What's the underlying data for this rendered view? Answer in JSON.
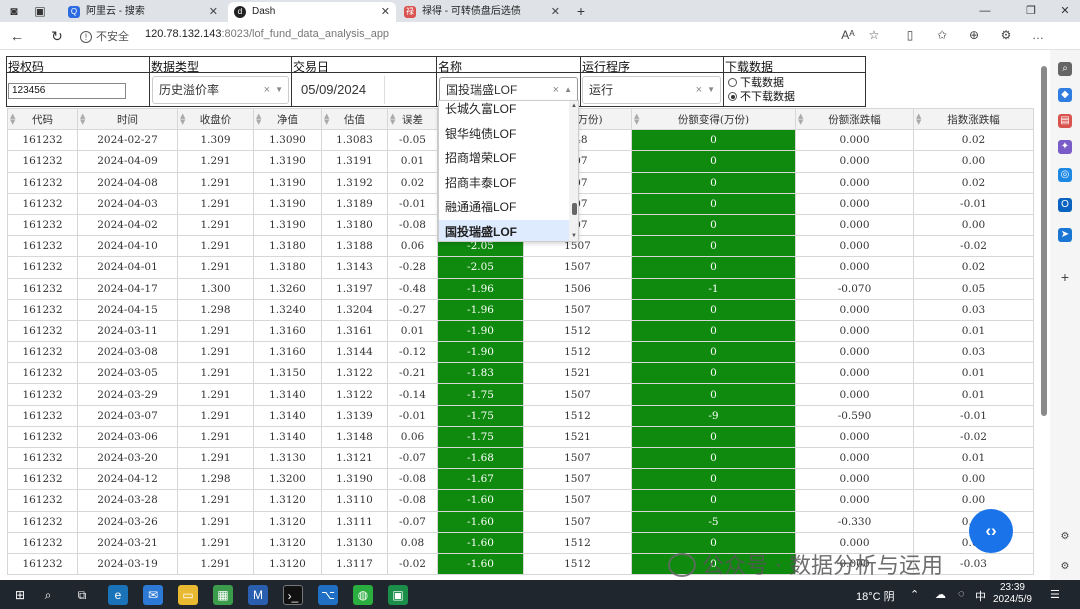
{
  "browser": {
    "tabs": [
      {
        "title": "阿里云 - 搜索",
        "active": false
      },
      {
        "title": "Dash",
        "active": true
      },
      {
        "title": "禄得 - 可转债盘后选债",
        "active": false
      }
    ],
    "address": {
      "insecure_label": "不安全",
      "url_host": "120.78.132.143",
      "url_rest": ":8023/lof_fund_data_analysis_app"
    }
  },
  "controls": {
    "auth": {
      "label": "授权码",
      "value": "123456"
    },
    "data_type": {
      "label": "数据类型",
      "value": "历史溢价率"
    },
    "trade_date": {
      "label": "交易日",
      "value": "05/09/2024"
    },
    "name": {
      "label": "名称",
      "value": "国投瑞盛LOF"
    },
    "run": {
      "label": "运行程序",
      "value": "运行"
    },
    "download": {
      "label": "下载数据",
      "options": [
        "下载数据",
        "不下载数据"
      ],
      "selected": "不下载数据"
    }
  },
  "dropdown": {
    "items": [
      "长城久富LOF",
      "银华纯债LOF",
      "招商增荣LOF",
      "招商丰泰LOF",
      "融通通福LOF",
      "国投瑞盛LOF"
    ],
    "selected": "国投瑞盛LOF"
  },
  "table": {
    "headers": [
      "代码",
      "时间",
      "收盘价",
      "净值",
      "估值",
      "误差",
      "溢价率",
      "份额(万份)",
      "份额变得(万份)",
      "份额涨跌幅",
      "指数涨跌幅"
    ],
    "rows": [
      [
        "161232",
        "2024-02-27",
        "1.309",
        "1.3090",
        "1.3083",
        "-0.05",
        "",
        "548",
        "0",
        "0.000",
        "0.02"
      ],
      [
        "161232",
        "2024-04-09",
        "1.291",
        "1.3190",
        "1.3191",
        "0.01",
        "",
        "507",
        "0",
        "0.000",
        "0.00"
      ],
      [
        "161232",
        "2024-04-08",
        "1.291",
        "1.3190",
        "1.3192",
        "0.02",
        "",
        "507",
        "0",
        "0.000",
        "0.02"
      ],
      [
        "161232",
        "2024-04-03",
        "1.291",
        "1.3190",
        "1.3189",
        "-0.01",
        "",
        "507",
        "0",
        "0.000",
        "-0.01"
      ],
      [
        "161232",
        "2024-04-02",
        "1.291",
        "1.3190",
        "1.3180",
        "-0.08",
        "",
        "507",
        "0",
        "0.000",
        "0.00"
      ],
      [
        "161232",
        "2024-04-10",
        "1.291",
        "1.3180",
        "1.3188",
        "0.06",
        "-2.05",
        "1507",
        "0",
        "0.000",
        "-0.02"
      ],
      [
        "161232",
        "2024-04-01",
        "1.291",
        "1.3180",
        "1.3143",
        "-0.28",
        "-2.05",
        "1507",
        "0",
        "0.000",
        "0.02"
      ],
      [
        "161232",
        "2024-04-17",
        "1.300",
        "1.3260",
        "1.3197",
        "-0.48",
        "-1.96",
        "1506",
        "-1",
        "-0.070",
        "0.05"
      ],
      [
        "161232",
        "2024-04-15",
        "1.298",
        "1.3240",
        "1.3204",
        "-0.27",
        "-1.96",
        "1507",
        "0",
        "0.000",
        "0.03"
      ],
      [
        "161232",
        "2024-03-11",
        "1.291",
        "1.3160",
        "1.3161",
        "0.01",
        "-1.90",
        "1512",
        "0",
        "0.000",
        "0.01"
      ],
      [
        "161232",
        "2024-03-08",
        "1.291",
        "1.3160",
        "1.3144",
        "-0.12",
        "-1.90",
        "1512",
        "0",
        "0.000",
        "0.03"
      ],
      [
        "161232",
        "2024-03-05",
        "1.291",
        "1.3150",
        "1.3122",
        "-0.21",
        "-1.83",
        "1521",
        "0",
        "0.000",
        "0.01"
      ],
      [
        "161232",
        "2024-03-29",
        "1.291",
        "1.3140",
        "1.3122",
        "-0.14",
        "-1.75",
        "1507",
        "0",
        "0.000",
        "0.01"
      ],
      [
        "161232",
        "2024-03-07",
        "1.291",
        "1.3140",
        "1.3139",
        "-0.01",
        "-1.75",
        "1512",
        "-9",
        "-0.590",
        "-0.01"
      ],
      [
        "161232",
        "2024-03-06",
        "1.291",
        "1.3140",
        "1.3148",
        "0.06",
        "-1.75",
        "1521",
        "0",
        "0.000",
        "-0.02"
      ],
      [
        "161232",
        "2024-03-20",
        "1.291",
        "1.3130",
        "1.3121",
        "-0.07",
        "-1.68",
        "1507",
        "0",
        "0.000",
        "0.01"
      ],
      [
        "161232",
        "2024-04-12",
        "1.298",
        "1.3200",
        "1.3190",
        "-0.08",
        "-1.67",
        "1507",
        "0",
        "0.000",
        "0.00"
      ],
      [
        "161232",
        "2024-03-28",
        "1.291",
        "1.3120",
        "1.3110",
        "-0.08",
        "-1.60",
        "1507",
        "0",
        "0.000",
        "0.00"
      ],
      [
        "161232",
        "2024-03-26",
        "1.291",
        "1.3120",
        "1.3111",
        "-0.07",
        "-1.60",
        "1507",
        "-5",
        "-0.330",
        "0.00"
      ],
      [
        "161232",
        "2024-03-21",
        "1.291",
        "1.3120",
        "1.3130",
        "0.08",
        "-1.60",
        "1512",
        "0",
        "0.000",
        "0.00"
      ],
      [
        "161232",
        "2024-03-19",
        "1.291",
        "1.3120",
        "1.3117",
        "-0.02",
        "-1.60",
        "1512",
        "0",
        "0.000",
        "-0.03"
      ]
    ]
  },
  "watermark": {
    "text": "公众号 · 数据分析与运用"
  },
  "taskbar": {
    "weather": "18°C 阴",
    "ime": "中",
    "time": "23:39",
    "date": "2024/5/9"
  },
  "colors": {
    "green_cell": "#0f8a0f",
    "fab": "#1a73e8"
  }
}
